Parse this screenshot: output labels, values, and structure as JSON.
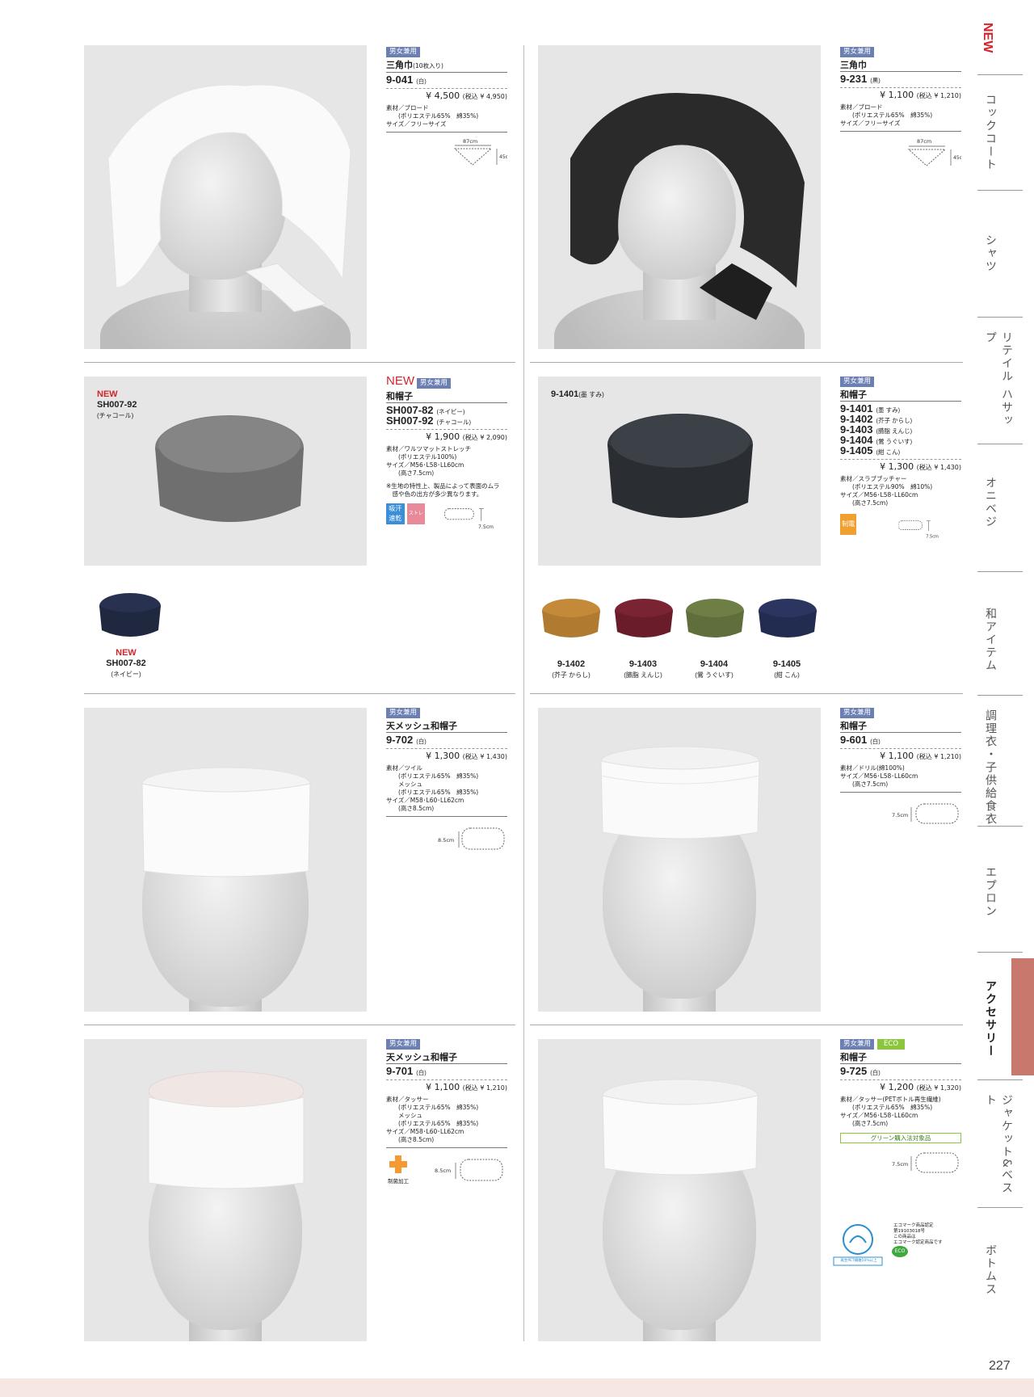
{
  "side_tabs": [
    {
      "label": "NEW",
      "active": false
    },
    {
      "label": "コックコート",
      "active": false
    },
    {
      "label": "シャツ",
      "active": false
    },
    {
      "label": "リテイル ハサップ",
      "active": false
    },
    {
      "label": "オニベジ",
      "active": false
    },
    {
      "label": "和アイテム",
      "active": false
    },
    {
      "label": "調理衣・子供給食衣",
      "active": false
    },
    {
      "label": "エプロン",
      "active": false
    },
    {
      "label": "アクセサリー",
      "active": true
    },
    {
      "label": "ジャケット&ベスト",
      "active": false
    },
    {
      "label": "ボトムス",
      "active": false
    }
  ],
  "colors": {
    "accent": "#c8786c",
    "badge": "#6b7fb3",
    "eco": "#8cc63f",
    "new_red": "#d2262c",
    "footer": "#f7e7e3"
  },
  "page_number": "227",
  "products": {
    "p9041": {
      "badge": "男女兼用",
      "name": "三角巾",
      "name_note": "(10枚入り)",
      "code": "9-041",
      "color": "(白)",
      "price": "¥ 4,500",
      "tax": "(税込 ¥ 4,950)",
      "spec": "素材／ブロード\n　　(ポリエステル65%　綿35%)\nサイズ／フリーサイズ",
      "dim_w": "87cm",
      "dim_h": "45cm"
    },
    "p9231": {
      "badge": "男女兼用",
      "name": "三角巾",
      "code": "9-231",
      "color": "(黒)",
      "price": "¥ 1,100",
      "tax": "(税込 ¥ 1,210)",
      "spec": "素材／ブロード\n　　(ポリエステル65%　綿35%)\nサイズ／フリーサイズ",
      "dim_w": "87cm",
      "dim_h": "45cm"
    },
    "sh007": {
      "new": "NEW",
      "badge": "男女兼用",
      "name": "和帽子",
      "code1": "SH007-82",
      "color1": "(ネイビー)",
      "code2": "SH007-92",
      "color2": "(チャコール)",
      "price": "¥ 1,900",
      "tax": "(税込 ¥ 2,090)",
      "spec": "素材／ワルツマットストレッチ\n　　(ポリエステル100%)\nサイズ／M56･L58･LL60cm\n　　(高さ7.5cm)",
      "note": "※生地の特性上、製品によって表面のムラ\n　感や色の出方が多少異なります。",
      "func1": "吸汗速乾",
      "func2": "ストレッチ",
      "dim": "7.5cm",
      "photo_label_new": "NEW",
      "photo_label_code": "SH007-92",
      "photo_label_color": "(チャコール)",
      "sub_label_new": "NEW",
      "sub_label_code": "SH007-82",
      "sub_label_color": "(ネイビー)"
    },
    "p1401": {
      "photo_label": "9-1401",
      "photo_label_color": "(墨 すみ)",
      "badge": "男女兼用",
      "name": "和帽子",
      "codes": [
        {
          "code": "9-1401",
          "color": "(墨 すみ)"
        },
        {
          "code": "9-1402",
          "color": "(芥子 からし)"
        },
        {
          "code": "9-1403",
          "color": "(臙脂 えんじ)"
        },
        {
          "code": "9-1404",
          "color": "(鶯 うぐいす)"
        },
        {
          "code": "9-1405",
          "color": "(紺 こん)"
        }
      ],
      "price": "¥ 1,300",
      "tax": "(税込 ¥ 1,430)",
      "spec": "素材／スラブブッチャー\n　　(ポリエステル90%　綿10%)\nサイズ／M56･L58･LL60cm\n　　(高さ7.5cm)",
      "func": "制電",
      "dim": "7.5cm",
      "swatches": [
        {
          "code": "9-1402",
          "color": "(芥子 からし)",
          "hex": "#c48a3a"
        },
        {
          "code": "9-1403",
          "color": "(臙脂 えんじ)",
          "hex": "#7a2333"
        },
        {
          "code": "9-1404",
          "color": "(鶯 うぐいす)",
          "hex": "#6e7f45"
        },
        {
          "code": "9-1405",
          "color": "(紺 こん)",
          "hex": "#2b3560"
        }
      ]
    },
    "p9702": {
      "badge": "男女兼用",
      "name": "天メッシュ和帽子",
      "code": "9-702",
      "color": "(白)",
      "price": "¥ 1,300",
      "tax": "(税込 ¥ 1,430)",
      "spec": "素材／ツイル\n　　(ポリエステル65%　綿35%)\n　　メッシュ\n　　(ポリエステル65%　綿35%)\nサイズ／M58･L60･LL62cm\n　　(高さ8.5cm)",
      "dim": "8.5cm"
    },
    "p9601": {
      "badge": "男女兼用",
      "name": "和帽子",
      "code": "9-601",
      "color": "(白)",
      "price": "¥ 1,100",
      "tax": "(税込 ¥ 1,210)",
      "spec": "素材／ドリル(綿100%)\nサイズ／M56･L58･LL60cm\n　　(高さ7.5cm)",
      "dim": "7.5cm"
    },
    "p9701": {
      "badge": "男女兼用",
      "name": "天メッシュ和帽子",
      "code": "9-701",
      "color": "(白)",
      "price": "¥ 1,100",
      "tax": "(税込 ¥ 1,210)",
      "spec": "素材／タッサー\n　　(ポリエステル65%　綿35%)\n　　メッシュ\n　　(ポリエステル65%　綿35%)\nサイズ／M58･L60･LL62cm\n　　(高さ8.5cm)",
      "func": "制菌加工",
      "dim": "8.5cm"
    },
    "p9725": {
      "badge": "男女兼用",
      "eco": "ECO",
      "name": "和帽子",
      "code": "9-725",
      "color": "(白)",
      "price": "¥ 1,200",
      "tax": "(税込 ¥ 1,320)",
      "spec": "素材／タッサー(PETボトル再生繊維)\n　　(ポリエステル65%　綿35%)\nサイズ／M56･L58･LL60cm\n　　(高さ7.5cm)",
      "green": "グリーン購入法対象品",
      "dim": "7.5cm",
      "pet_label": "再生PET繊維50%以上",
      "ecomark_text": "エコマーク商品認定\n第19103018号\nこの商品は\nエコマーク認定商品です",
      "eco_small": "ECO"
    }
  }
}
